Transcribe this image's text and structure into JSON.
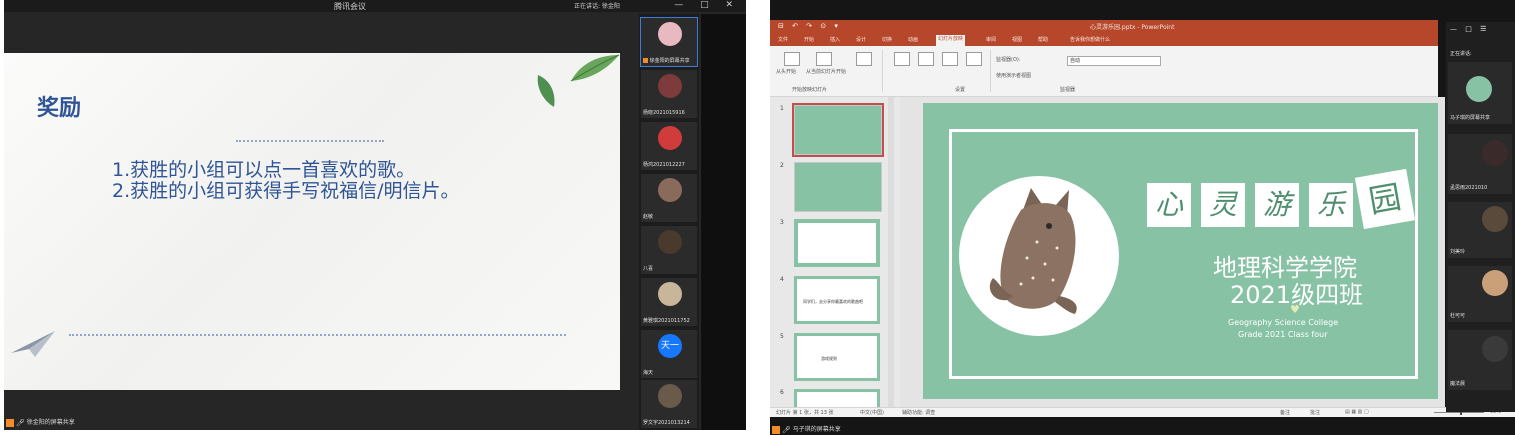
{
  "left_meeting": {
    "window_title": "腾讯会议",
    "speaking_text": "正在讲话: 徐金阳",
    "window_controls": "—  □  ✕",
    "slide": {
      "heading": "奖励",
      "line1": "1.获胜的小组可以点一首喜欢的歌。",
      "line2": "2.获胜的小组可获得手写祝福信/明信片。"
    },
    "presenter_label": "徐金阳的屏幕共享",
    "participants": [
      {
        "name": "徐金阳的屏幕共享",
        "avatar_color": "#e9b9c2"
      },
      {
        "name": "杨晓2021015916",
        "avatar_color": "#7d3b3b"
      },
      {
        "name": "杨鸿2021012227",
        "avatar_color": "#d03b3b"
      },
      {
        "name": "赵敏",
        "avatar_color": "#8a6a5a"
      },
      {
        "name": "八喜",
        "avatar_color": "#4a3a2c"
      },
      {
        "name": "黄雅琪2021011752",
        "avatar_color": "#c8b59a"
      },
      {
        "name": "海天",
        "avatar_text": "天一",
        "avatar_color": "#1677ff"
      },
      {
        "name": "罗文宇2021013214",
        "avatar_color": "#6a5a4a"
      }
    ]
  },
  "right_share": {
    "ppt": {
      "title": "心灵游乐园.pptx - PowerPoint",
      "qat": "⊟ ↶ ↷ ⊙ ▾",
      "tabs": [
        "文件",
        "开始",
        "插入",
        "设计",
        "切换",
        "动画",
        "幻灯片放映",
        "审阅",
        "视图",
        "帮助",
        "告诉我你想做什么"
      ],
      "active_tab": "幻灯片放映",
      "ribbon": {
        "group1_label": "开始放映幻灯片",
        "group2_label": "设置",
        "group3_label": "监视器",
        "btn_from_start": "从头开始",
        "btn_from_current": "从当前幻灯片开始",
        "monitor_label": "监视器(O):",
        "monitor_value": "自动",
        "presenter_view": "使用演示者视图"
      },
      "thumb_numbers": [
        "1",
        "2",
        "3",
        "4",
        "5",
        "6"
      ],
      "thumb_texts": [
        "同学们，去分享你最喜欢的歌曲吧",
        "游戏规则"
      ],
      "slide": {
        "title_chars": [
          "心",
          "灵",
          "游",
          "乐",
          "园"
        ],
        "school": "地理科学学院",
        "class": "2021级四班",
        "heart": "♥",
        "eng_line1": "Geography Science College",
        "eng_line2": "Grade 2021   Class four"
      },
      "status_left": "幻灯片 第 1 张，共 13 张",
      "status_lang": "中文(中国)",
      "status_access": "辅助功能: 调查",
      "status_notes": "备注",
      "status_comments": "批注",
      "zoom": "95%"
    },
    "share_label": "马子琪的屏幕共享",
    "panel": {
      "title": "— □ ☰",
      "subtitle": "正在讲话:",
      "participants": [
        {
          "name": "马子琪的屏幕共享",
          "avatar_color": "#88c2a5"
        },
        {
          "name": "孟思雨2021010",
          "avatar_color": "#3b2a2a"
        },
        {
          "name": "刘美玲",
          "avatar_color": "#5a4a3c"
        },
        {
          "name": "杜可可",
          "avatar_color": "#c9a07a"
        },
        {
          "name": "魔法晨",
          "avatar_color": "#3a3a3a"
        }
      ]
    }
  }
}
